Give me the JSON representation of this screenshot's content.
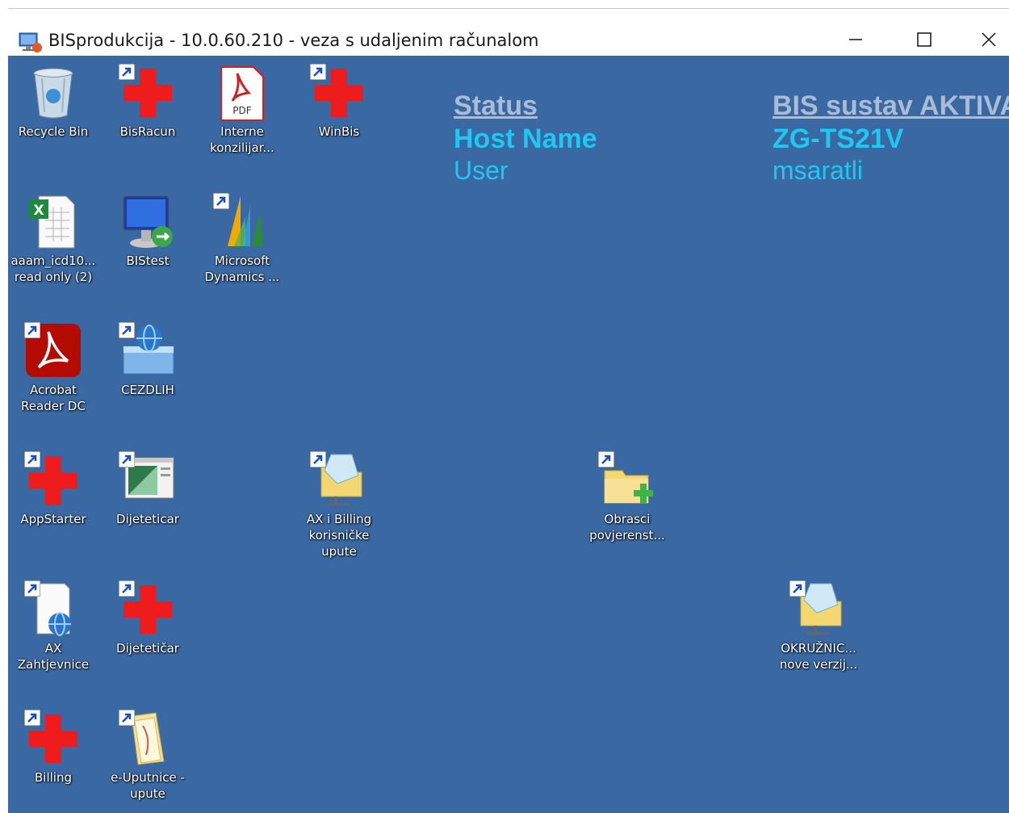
{
  "window": {
    "title": "BISprodukcija - 10.0.60.210 - veza s udaljenim računalom",
    "controls": {
      "minimize": "minimize-icon",
      "maximize": "maximize-icon",
      "close": "close-icon"
    }
  },
  "bginfo": {
    "status_label": "Status",
    "status_value": "BIS sustav AKTIVAN",
    "host_label": "Host Name",
    "host_value": "ZG-TS21V",
    "user_label": "User",
    "user_value": "msaratli",
    "colors": {
      "heading": "#a9bcd6",
      "value": "#1ec8f0",
      "desktop": "#3a68a2"
    }
  },
  "desktop_icons": [
    {
      "label": "Recycle Bin",
      "icon": "recycle-bin-icon"
    },
    {
      "label": "BisRacun",
      "icon": "red-cross-icon"
    },
    {
      "label": "Interne\nkonzilijar...",
      "icon": "pdf-file-icon"
    },
    {
      "label": "WinBis",
      "icon": "red-cross-icon"
    },
    {
      "label": "aaam_icd10...\nread only (2)",
      "icon": "excel-file-icon"
    },
    {
      "label": "BIStest",
      "icon": "remote-desktop-icon"
    },
    {
      "label": "Microsoft\nDynamics ...",
      "icon": "dynamics-icon"
    },
    {
      "label": "Acrobat\nReader DC",
      "icon": "acrobat-reader-icon"
    },
    {
      "label": "CEZDLIH",
      "icon": "network-globe-icon"
    },
    {
      "label": "AppStarter",
      "icon": "red-cross-icon"
    },
    {
      "label": "Dijeteticar",
      "icon": "app-window-icon"
    },
    {
      "label": "AX i Billing\nkorisničke\nupute",
      "icon": "network-folder-icon"
    },
    {
      "label": "Obrasci\npovjerenst...",
      "icon": "folder-add-icon"
    },
    {
      "label": "AX Zahtjevnice",
      "icon": "web-document-icon"
    },
    {
      "label": "Dijetetičar",
      "icon": "red-cross-icon"
    },
    {
      "label": "OKRUŽNIC...\nnove verzij...",
      "icon": "network-folder-icon"
    },
    {
      "label": "Billing",
      "icon": "red-cross-icon"
    },
    {
      "label": "e-Uputnice -\nupute",
      "icon": "folder-document-icon"
    }
  ]
}
